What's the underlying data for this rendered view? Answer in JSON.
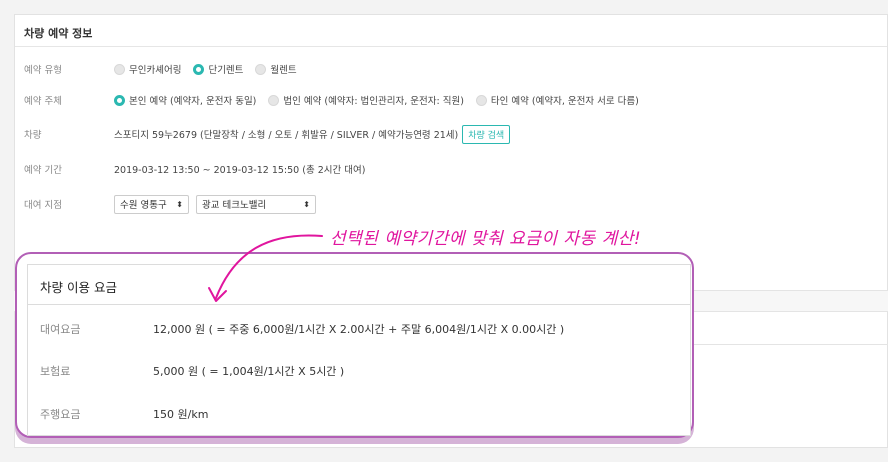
{
  "section": {
    "title": "차량 예약 정보"
  },
  "rows": {
    "type": {
      "label": "예약 유형",
      "options": [
        "무인카셰어링",
        "단기렌트",
        "월렌트"
      ],
      "selected": "단기렌트"
    },
    "subject": {
      "label": "예약 주체",
      "options": [
        "본인 예약 (예약자, 운전자 동일)",
        "법인 예약 (예약자: 법인관리자, 운전자: 직원)",
        "타인 예약 (예약자, 운전자 서로 다름)"
      ],
      "selected": "본인 예약 (예약자, 운전자 동일)"
    },
    "vehicle": {
      "label": "차량",
      "value": "스포티지 59누2679 (단말장착 / 소형 / 오토 / 휘발유 / SILVER / 예약가능연령 21세)",
      "search_button": "차량 검색"
    },
    "period": {
      "label": "예약 기간",
      "value": "2019-03-12 13:50 ~ 2019-03-12 15:50 (총 2시간 대여)"
    },
    "branch": {
      "label": "대여 지점",
      "region": "수원 영통구",
      "branch": "광교 테크노밸리"
    }
  },
  "annotation": {
    "text": "선택된 예약기간에 맞춰 요금이 자동 계산!"
  },
  "fee_card": {
    "title": "차량 이용 요금",
    "rental": {
      "label": "대여요금",
      "value": "12,000 원 ( = 주중 6,000원/1시간 X 2.00시간 + 주말 6,004원/1시간 X 0.00시간 )"
    },
    "insurance": {
      "label": "보험료",
      "value": "5,000 원 ( = 1,004원/1시간 X 5시간 )"
    },
    "driving": {
      "label": "주행요금",
      "value": "150 원/km"
    }
  },
  "colors": {
    "accent": "#2bb8b1",
    "highlight": "#b25fb6",
    "annotation": "#e0159e"
  }
}
